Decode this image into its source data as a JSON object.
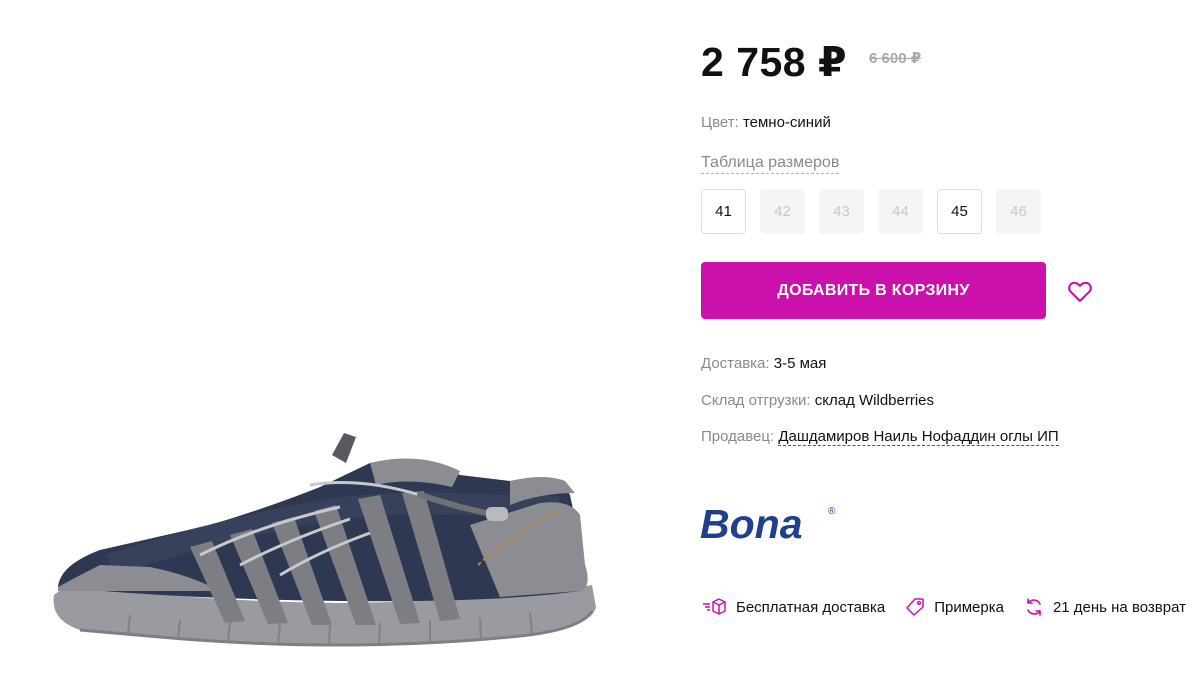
{
  "price": {
    "current": "2 758 ₽",
    "old": "6 600 ₽"
  },
  "color": {
    "label": "Цвет:",
    "value": "темно-синий"
  },
  "size_table_link": "Таблица размеров",
  "sizes": [
    {
      "label": "41",
      "available": true
    },
    {
      "label": "42",
      "available": false
    },
    {
      "label": "43",
      "available": false
    },
    {
      "label": "44",
      "available": false
    },
    {
      "label": "45",
      "available": true
    },
    {
      "label": "46",
      "available": false
    }
  ],
  "add_to_cart": "ДОБАВИТЬ В КОРЗИНУ",
  "delivery": {
    "label": "Доставка:",
    "value": "3-5 мая"
  },
  "warehouse": {
    "label": "Склад отгрузки:",
    "value": "склад Wildberries"
  },
  "seller": {
    "label": "Продавец:",
    "value": "Дашдамиров Наиль Нофаддин оглы ИП"
  },
  "brand": {
    "logo_text": "Bona",
    "mark": "®"
  },
  "features": [
    {
      "icon": "delivery-box-icon",
      "label": "Бесплатная доставка"
    },
    {
      "icon": "tag-icon",
      "label": "Примерка"
    },
    {
      "icon": "return-arrows-icon",
      "label": "21 день на возврат"
    }
  ],
  "colors": {
    "accent": "#cb11ab",
    "muted": "#8a8a8a",
    "text": "#111111",
    "brand_blue": "#1f3f8f"
  }
}
